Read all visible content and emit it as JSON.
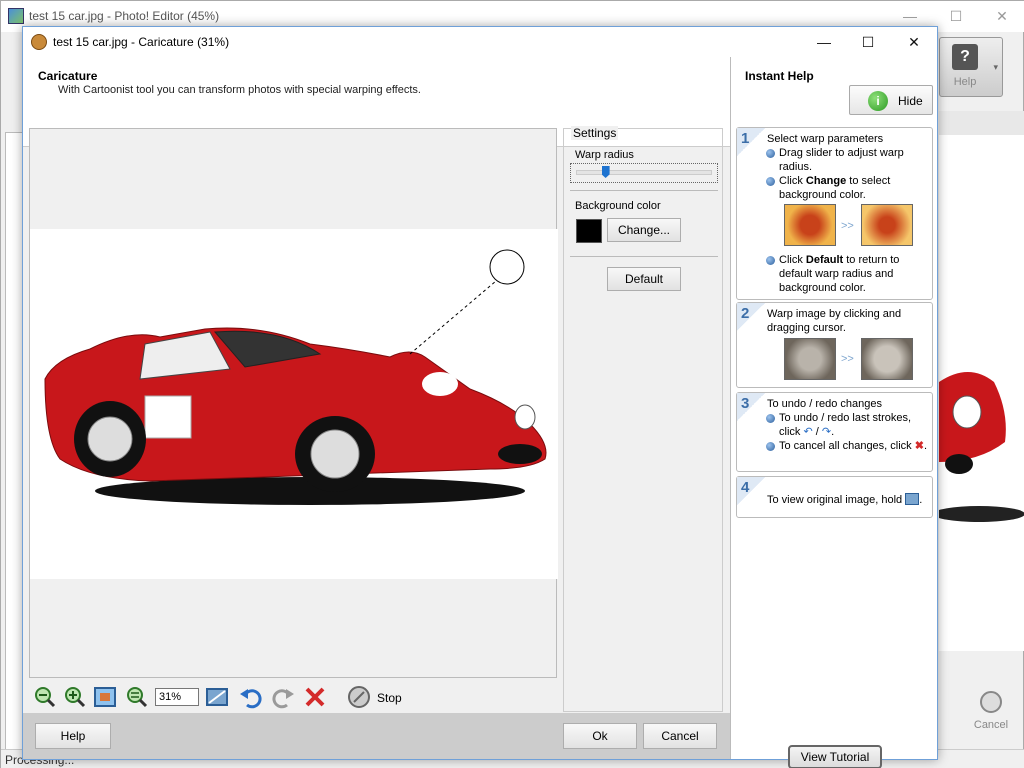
{
  "background": {
    "title": "test 15 car.jpg - Photo! Editor (45%)",
    "help_label": "Help",
    "cancel_label": "Cancel",
    "status": "Processing..."
  },
  "dialog": {
    "title": "test 15 car.jpg - Caricature (31%)",
    "header_title": "Caricature",
    "header_desc": "With Cartoonist tool you can transform photos with special warping effects.",
    "settings": {
      "title": "Settings",
      "warp_label": "Warp radius",
      "warp_value": 0.2,
      "bg_label": "Background color",
      "bg_color": "#000000",
      "change_label": "Change...",
      "default_label": "Default"
    },
    "toolbar": {
      "zoom_value": "31%",
      "stop_label": "Stop"
    },
    "buttons": {
      "help": "Help",
      "ok": "Ok",
      "cancel": "Cancel"
    }
  },
  "instant_help": {
    "title": "Instant Help",
    "hide_label": "Hide",
    "steps": [
      {
        "num": "1",
        "heading": "Select warp parameters",
        "b1": "Drag slider to adjust warp radius.",
        "b2_pre": "Click ",
        "b2_bold": "Change",
        "b2_post": " to select background color.",
        "b3_pre": "Click ",
        "b3_bold": "Default",
        "b3_post": " to return to default warp radius and background color."
      },
      {
        "num": "2",
        "heading": "Warp image by clicking and dragging cursor."
      },
      {
        "num": "3",
        "heading": "To undo / redo changes",
        "b1": "To undo / redo last strokes, click",
        "b2": "To cancel all changes, click"
      },
      {
        "num": "4",
        "heading": "To view original image, hold"
      }
    ],
    "tutorial_label": "View Tutorial"
  }
}
